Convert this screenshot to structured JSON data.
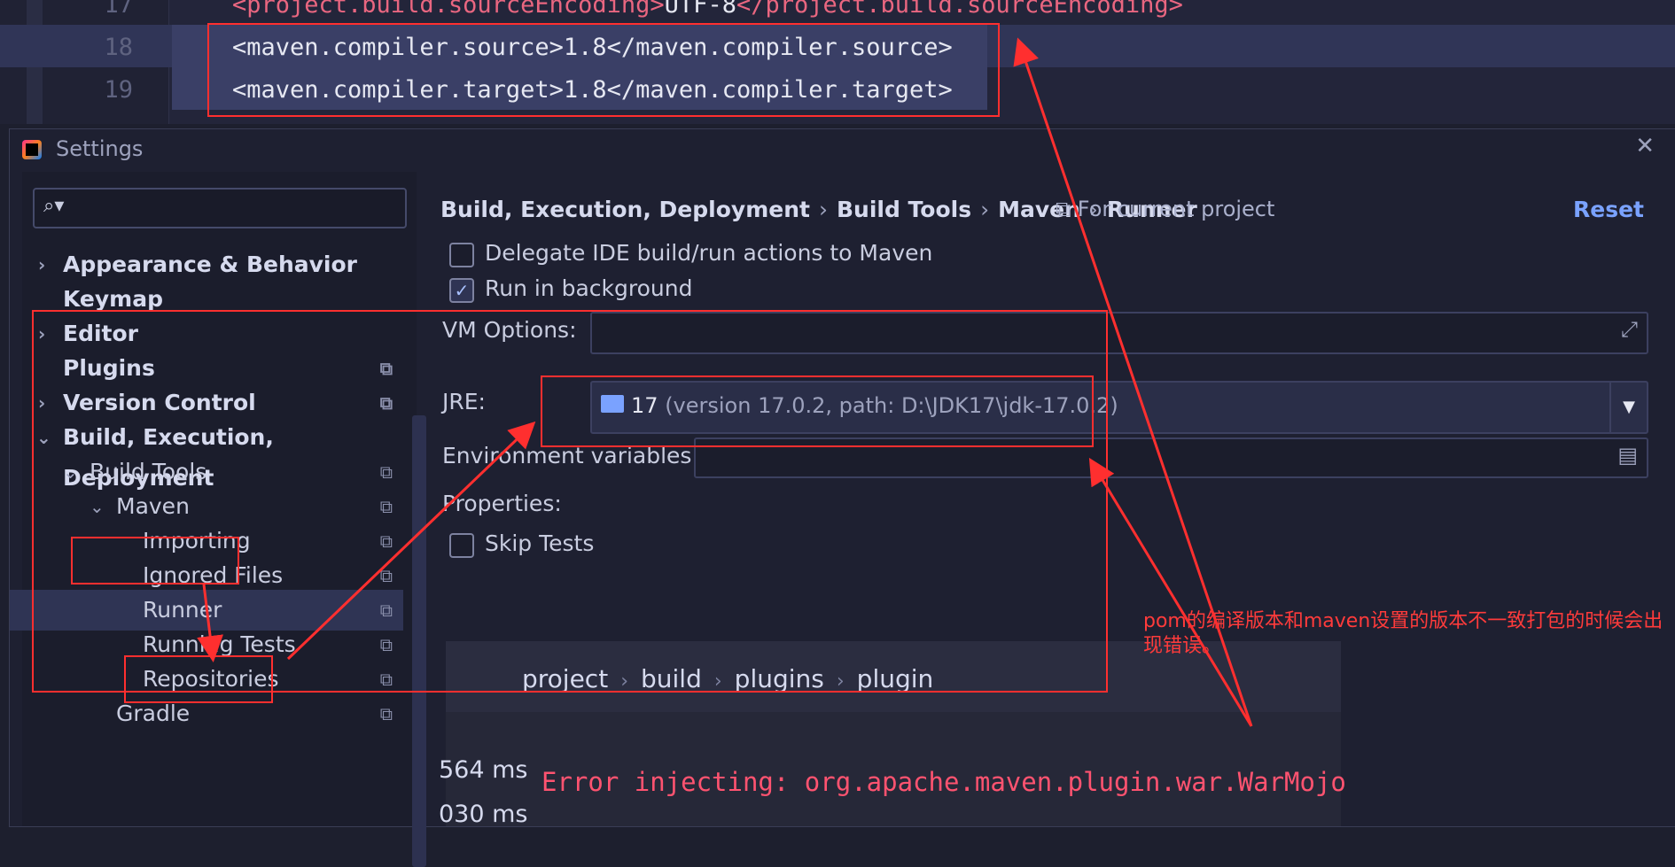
{
  "editor": {
    "lines": [
      {
        "number": "17",
        "open_tag": "<project.build.sourceEncoding>",
        "value": "UTF-8",
        "close_tag": "</project.build.sourceEncoding>"
      },
      {
        "number": "18",
        "text": "<maven.compiler.source>1.8</maven.compiler.source>"
      },
      {
        "number": "19",
        "text": "<maven.compiler.target>1.8</maven.compiler.target>"
      }
    ]
  },
  "dialog": {
    "title": "Settings",
    "close_glyph": "✕"
  },
  "search": {
    "icon": "search-icon",
    "glyph": "⌕▾",
    "value": ""
  },
  "tree": [
    {
      "label": "Appearance & Behavior",
      "chevron": "›",
      "bold": true
    },
    {
      "label": "Keymap",
      "bold": true
    },
    {
      "label": "Editor",
      "chevron": "›",
      "bold": true
    },
    {
      "label": "Plugins",
      "bold": true,
      "copy": "⧉"
    },
    {
      "label": "Version Control",
      "chevron": "›",
      "bold": true,
      "copy": "⧉"
    },
    {
      "label": "Build, Execution, Deployment",
      "chevron": "⌄",
      "bold": true
    },
    {
      "label": "Build Tools",
      "chevron": "⌄",
      "copy": "⧉"
    },
    {
      "label": "Maven",
      "chevron": "⌄",
      "copy": "⧉"
    },
    {
      "label": "Importing",
      "copy": "⧉"
    },
    {
      "label": "Ignored Files",
      "copy": "⧉"
    },
    {
      "label": "Runner",
      "copy": "⧉",
      "selected": true
    },
    {
      "label": "Running Tests",
      "copy": "⧉"
    },
    {
      "label": "Repositories",
      "copy": "⧉"
    },
    {
      "label": "Gradle",
      "copy": "⧉"
    }
  ],
  "breadcrumb": {
    "items": [
      "Build, Execution, Deployment",
      "Build Tools",
      "Maven",
      "Runner"
    ],
    "separator": "›",
    "scope_icon": "⧉",
    "scope": "For current project",
    "reset": "Reset"
  },
  "runner": {
    "delegate_label": "Delegate IDE build/run actions to Maven",
    "delegate_checked": false,
    "background_label": "Run in background",
    "background_checked": true,
    "check_glyph": "✓",
    "vm_options_label": "VM Options:",
    "vm_options_value": "",
    "expand_glyph": "⤢",
    "jre_label": "JRE:",
    "jre_value": "17",
    "jre_detail": "(version 17.0.2, path: D:\\JDK17\\jdk-17.0.2)",
    "dropdown_glyph": "▼",
    "env_label": "Environment variables:",
    "env_value": "",
    "env_icon_glyph": "▤",
    "properties_label": "Properties:",
    "skip_tests_label": "Skip Tests",
    "skip_tests_checked": false
  },
  "console": {
    "path": [
      "project",
      "build",
      "plugins",
      "plugin"
    ],
    "path_separator": "›",
    "times": [
      "564 ms",
      "030 ms"
    ],
    "error": "Error injecting: org.apache.maven.plugin.war.WarMojo"
  },
  "annotation": {
    "note": "pom的编译版本和maven设置的版本不一致打包的时候会出现错误。",
    "color": "#ff2f2f"
  }
}
